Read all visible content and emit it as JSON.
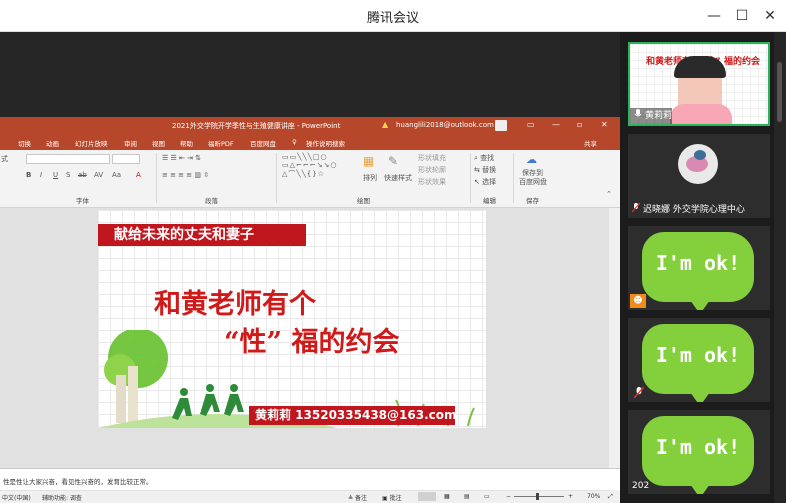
{
  "window": {
    "title": "腾讯会议",
    "minimize": "—",
    "maximize": "☐",
    "close": "✕"
  },
  "ppt": {
    "doc_title": "2021外交学院开学季性与生殖健康讲座 - PowerPoint",
    "user_email": "huanglili2018@outlook.com",
    "menu": [
      "切换",
      "动画",
      "幻灯片放映",
      "审阅",
      "视图",
      "帮助",
      "福昕PDF",
      "百度网盘",
      "操作说明搜索",
      "共享"
    ],
    "ribbon": {
      "groups": [
        "字体",
        "段落",
        "绘图",
        "编辑",
        "保存"
      ],
      "left_stub": "式",
      "font_buttons": [
        "B",
        "I",
        "U",
        "S",
        "ab",
        "AV",
        "Aa"
      ],
      "find": "查找",
      "replace": "替换",
      "select": "选择",
      "arrange": "排列",
      "quick_styles": "快速样式",
      "shape_fill": "形状填充",
      "shape_outline": "形状轮廓",
      "shape_effects": "形状效果",
      "save_to": "保存到",
      "baidu": "百度网盘"
    },
    "slide": {
      "banner": "献给未来的丈夫和妻子",
      "title_line1": "和黄老师有个",
      "title_line2": "“性” 福的约会",
      "contact": "黄莉莉 13520335438@163.com"
    },
    "notes": "性是性让大家兴奋，看见性兴奋的，发育比较正常。",
    "status": {
      "language": "中文(中国)",
      "accessibility": "辅助功能: 调查",
      "notes_btn": "备注",
      "comments_btn": "批注",
      "zoom": "70%"
    }
  },
  "participants": [
    {
      "name": "黄莉莉",
      "mini_title": "和黄老师有个“性” 福的约会",
      "active": true
    },
    {
      "name": "迟晓娜 外交学院心理中心",
      "active": false
    },
    {
      "name": "",
      "badge": "person",
      "active": false
    },
    {
      "name": "",
      "badge": "mic-muted",
      "active": false
    },
    {
      "name": "202",
      "active": false
    }
  ],
  "imok_text": "I'm ok!",
  "colors": {
    "ppt_red": "#b7472a",
    "slide_red": "#c0161e",
    "imok_green": "#84cf3c",
    "active_border": "#2bb55a"
  }
}
